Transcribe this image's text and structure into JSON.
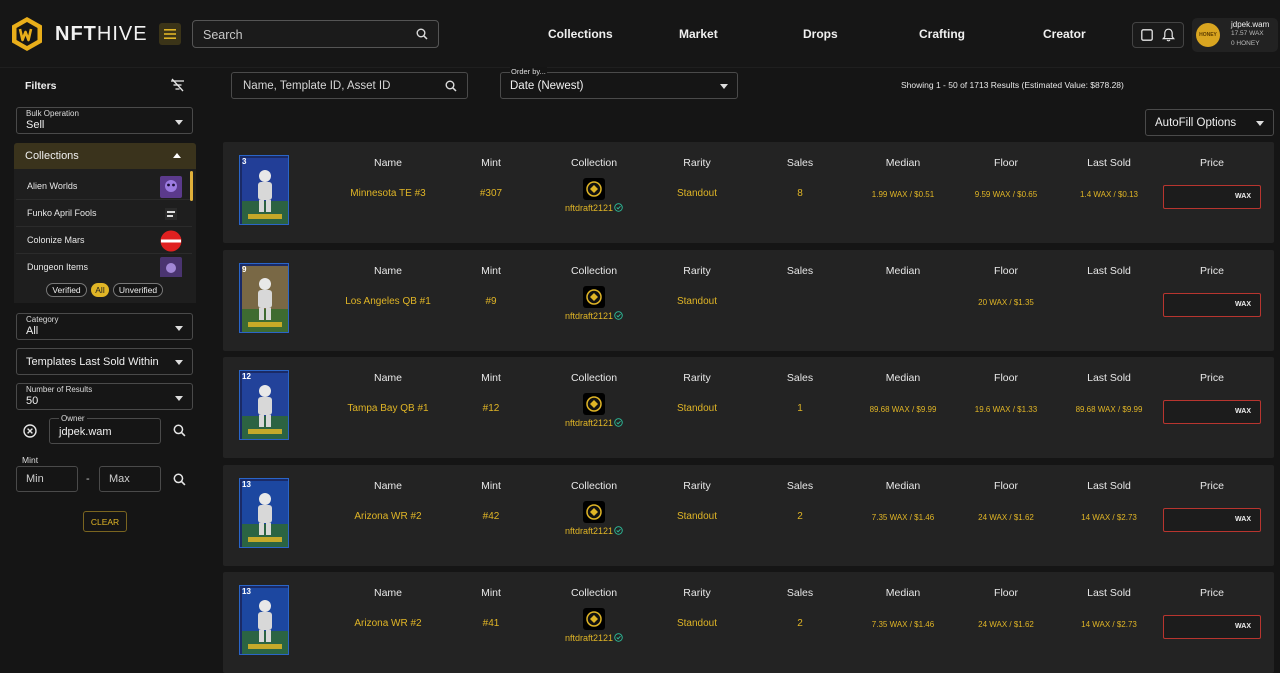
{
  "header": {
    "logo_bold": "NFT",
    "logo_light": "HIVE",
    "search_placeholder": "Search",
    "nav": [
      {
        "label": "Collections"
      },
      {
        "label": "Market"
      },
      {
        "label": "Drops"
      },
      {
        "label": "Crafting"
      },
      {
        "label": "Creator"
      }
    ],
    "user": {
      "name": "jdpek.wam",
      "wax": "17.57 WAX",
      "honey": "0 HONEY",
      "avatar_text": "HONEY"
    }
  },
  "sidebar": {
    "title": "Filters",
    "bulk": {
      "label": "Bulk Operation",
      "value": "Sell"
    },
    "collections": {
      "title": "Collections",
      "items": [
        {
          "name": "Alien Worlds",
          "icon": "alien-worlds-icon"
        },
        {
          "name": "Funko April Fools",
          "icon": "funko-icon"
        },
        {
          "name": "Colonize Mars",
          "icon": "colonize-mars-icon"
        },
        {
          "name": "Dungeon Items",
          "icon": "dungeon-items-icon"
        }
      ]
    },
    "verified": {
      "verified": "Verified",
      "all": "All",
      "unverified": "Unverified"
    },
    "category": {
      "label": "Category",
      "value": "All"
    },
    "templates": {
      "value": "Templates Last Sold Within"
    },
    "num_results": {
      "label": "Number of Results",
      "value": "50"
    },
    "owner": {
      "label": "Owner",
      "value": "jdpek.wam"
    },
    "mint": {
      "label": "Mint",
      "min": "Min",
      "max": "Max",
      "separator": "-"
    },
    "clear": "CLEAR"
  },
  "toolbar": {
    "search_placeholder": "Name, Template ID, Asset ID",
    "order": {
      "label": "Order by...",
      "value": "Date (Newest)"
    },
    "results": "Showing 1 - 50 of 1713 Results (Estimated Value: $878.28)",
    "autofill": "AutoFill Options"
  },
  "columns": {
    "name": "Name",
    "mint": "Mint",
    "collection": "Collection",
    "rarity": "Rarity",
    "sales": "Sales",
    "median": "Median",
    "floor": "Floor",
    "last_sold": "Last Sold",
    "price": "Price"
  },
  "rows": [
    {
      "name": "Minnesota TE #3",
      "mint": "#307",
      "collection": "nftdraft2121",
      "rarity": "Standout",
      "sales": "8",
      "median": "1.99 WAX / $0.51",
      "floor": "9.59 WAX / $0.65",
      "last_sold": "1.4 WAX / $0.13",
      "currency": "WAX",
      "card_color": "#2a4fc0",
      "card_number": "3"
    },
    {
      "name": "Los Angeles QB #1",
      "mint": "#9",
      "collection": "nftdraft2121",
      "rarity": "Standout",
      "sales": "",
      "median": "",
      "floor": "20 WAX / $1.35",
      "last_sold": "",
      "currency": "WAX",
      "card_color": "#c89a2a",
      "card_number": "9"
    },
    {
      "name": "Tampa Bay QB #1",
      "mint": "#12",
      "collection": "nftdraft2121",
      "rarity": "Standout",
      "sales": "1",
      "median": "89.68 WAX / $9.99",
      "floor": "19.6 WAX / $1.33",
      "last_sold": "89.68 WAX / $9.99",
      "currency": "WAX",
      "card_color": "#2a56c4",
      "card_number": "12"
    },
    {
      "name": "Arizona WR #2",
      "mint": "#42",
      "collection": "nftdraft2121",
      "rarity": "Standout",
      "sales": "2",
      "median": "7.35 WAX / $1.46",
      "floor": "24 WAX / $1.62",
      "last_sold": "14 WAX / $2.73",
      "currency": "WAX",
      "card_color": "#1f5fd0",
      "card_number": "13"
    },
    {
      "name": "Arizona WR #2",
      "mint": "#41",
      "collection": "nftdraft2121",
      "rarity": "Standout",
      "sales": "2",
      "median": "7.35 WAX / $1.46",
      "floor": "24 WAX / $1.62",
      "last_sold": "14 WAX / $2.73",
      "currency": "WAX",
      "card_color": "#1f5fd0",
      "card_number": "13"
    }
  ],
  "colors": {
    "accent": "#e0b526",
    "background": "#151515",
    "row": "#232323",
    "price_border": "#b8352f"
  }
}
